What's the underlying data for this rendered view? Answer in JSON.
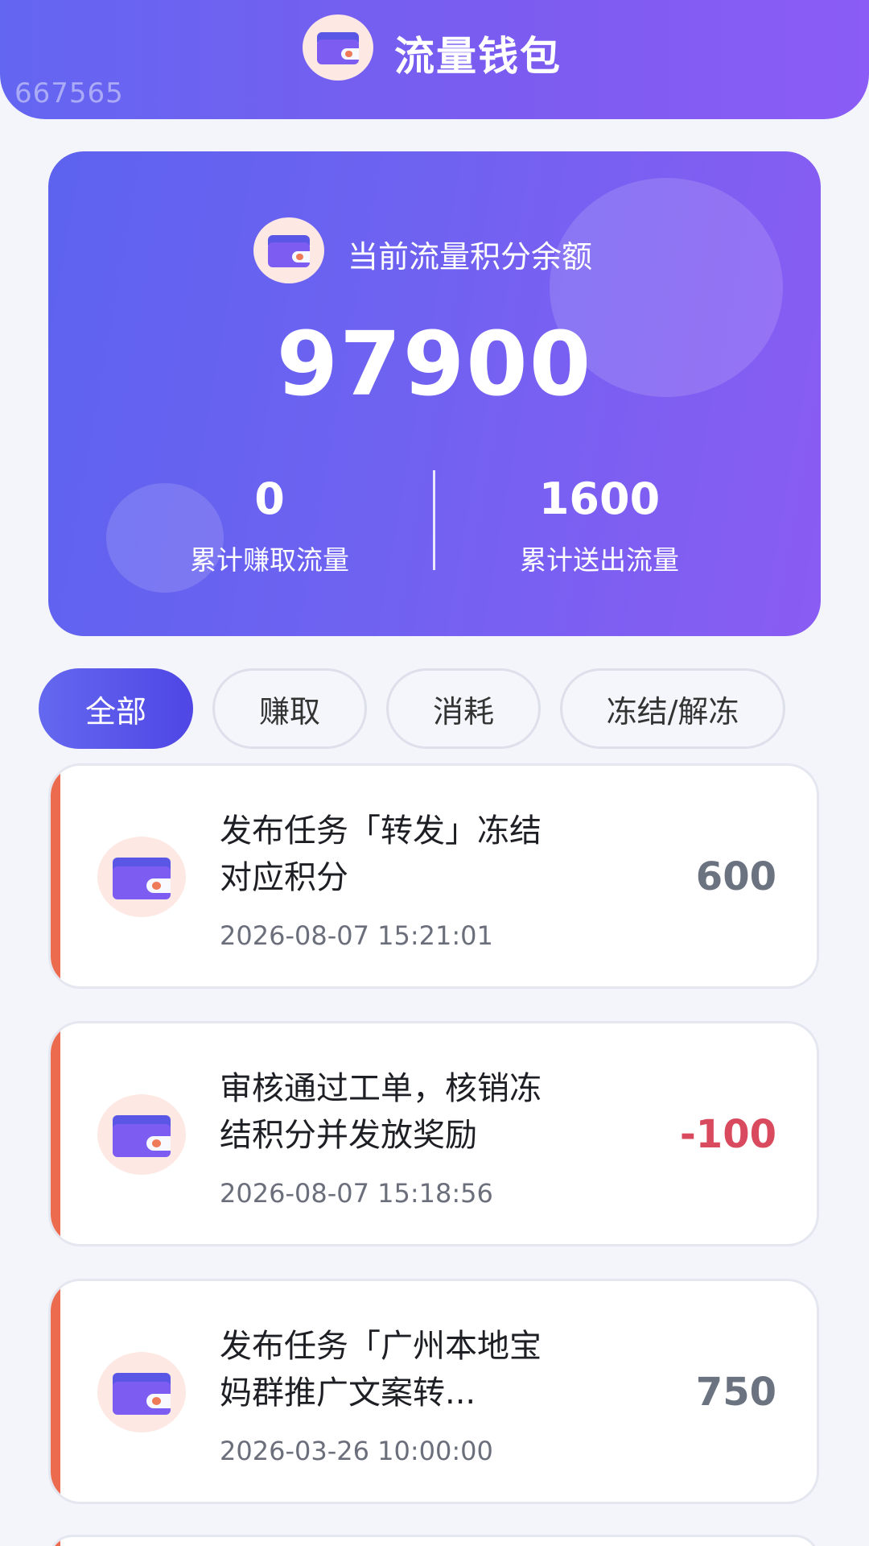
{
  "header": {
    "title": "流量钱包",
    "watermark": "667565",
    "logo_icon": "wallet-icon"
  },
  "balance_card": {
    "label": "当前流量积分余额",
    "balance": "97900",
    "earned_value": "0",
    "earned_label": "累计赚取流量",
    "sent_value": "1600",
    "sent_label": "累计送出流量",
    "icon": "wallet-icon"
  },
  "tabs": [
    {
      "label": "全部",
      "active": true
    },
    {
      "label": "赚取",
      "active": false
    },
    {
      "label": "消耗",
      "active": false
    },
    {
      "label": "冻结/解冻",
      "active": false
    }
  ],
  "records": [
    {
      "title": "发布任务「转发」冻结对应积分",
      "time": "2026-08-07 15:21:01",
      "amount": "600",
      "kind": "neutral",
      "icon": "wallet-icon"
    },
    {
      "title": "审核通过工单，核销冻结积分并发放奖励",
      "time": "2026-08-07 15:18:56",
      "amount": "-100",
      "kind": "negative",
      "icon": "wallet-icon"
    },
    {
      "title": "发布任务「广州本地宝妈群推广文案转...",
      "time": "2026-03-26 10:00:00",
      "amount": "750",
      "kind": "neutral",
      "icon": "wallet-icon"
    }
  ],
  "colors": {
    "accent": "#6366f1",
    "accent_end": "#8b5cf6",
    "record_bar": "#ec6b4f",
    "negative": "#d94a5e",
    "neutral": "#6b7280"
  }
}
